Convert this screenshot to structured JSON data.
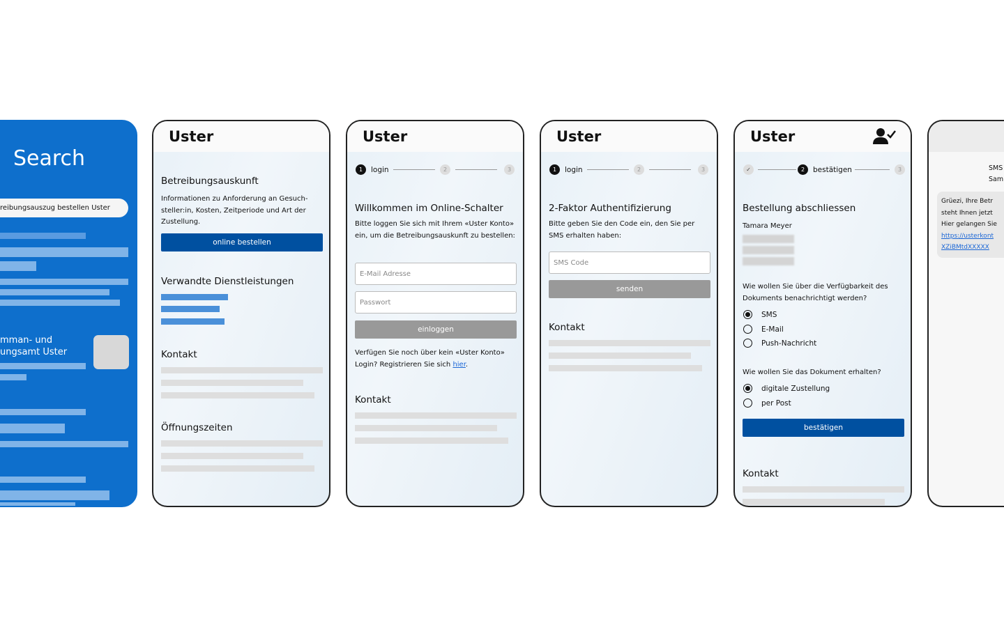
{
  "search_screen": {
    "title": "Search",
    "query": "reibungsauszug bestellen Uster",
    "result_title_line1": "mman- und",
    "result_title_line2": "ungsamt Uster"
  },
  "brand": "Uster",
  "screen1": {
    "heading": "Betreibungsauskunft",
    "text": "Informationen zu Anforderung an Gesuch-steller:in, Kosten, Zeitperiode und Art der Zustellung.",
    "button": "online bestellen",
    "related": "Verwandte Dienstleistungen",
    "contact": "Kontakt",
    "hours": "Öffnungszeiten"
  },
  "screen2": {
    "steps": [
      {
        "label": "login",
        "num": "1"
      },
      {
        "num": "2"
      },
      {
        "num": "3"
      }
    ],
    "heading": "Willkommen im Online-Schalter",
    "text": "Bitte loggen Sie sich mit Ihrem «Uster Konto» ein, um die Betreibungsauskunft zu bestellen:",
    "email_placeholder": "E-Mail Adresse",
    "password_placeholder": "Passwort",
    "button": "einloggen",
    "register_text": "Verfügen Sie noch über kein «Uster Konto» Login? Registrieren Sie sich ",
    "register_link": "hier",
    "register_end": ".",
    "contact": "Kontakt"
  },
  "screen3": {
    "steps": [
      {
        "label": "login",
        "num": "1"
      },
      {
        "num": "2"
      },
      {
        "num": "3"
      }
    ],
    "heading": "2-Faktor Authentifizierung",
    "text": "Bitte geben Sie den Code ein, den Sie per SMS erhalten haben:",
    "code_placeholder": "SMS Code",
    "button": "senden",
    "contact": "Kontakt"
  },
  "screen4": {
    "steps": [
      {
        "label": "",
        "num": "✓"
      },
      {
        "label": "bestätigen",
        "num": "2"
      },
      {
        "num": "3"
      }
    ],
    "heading": "Bestellung abschliessen",
    "name": "Tamara Meyer",
    "q1": "Wie wollen Sie über die Verfügbarkeit des Dokuments benachrichtigt werden?",
    "q1_options": [
      {
        "label": "SMS",
        "selected": true
      },
      {
        "label": "E-Mail",
        "selected": false
      },
      {
        "label": "Push-Nachricht",
        "selected": false
      }
    ],
    "q2": "Wie wollen Sie das Dokument erhalten?",
    "q2_options": [
      {
        "label": "digitale Zustellung",
        "selected": true
      },
      {
        "label": "per Post",
        "selected": false
      }
    ],
    "button": "bestätigen",
    "contact": "Kontakt",
    "user_icon": "user-check-icon"
  },
  "screen5": {
    "sender_line1": "SMS",
    "sender_line2": "Sam",
    "message_lines": [
      "Grüezi, Ihre Betr",
      "steht Ihnen jetzt",
      "Hier gelangen Sie"
    ],
    "link_line1": "https://usterkont",
    "link_line2": "XZiBMtdXXXXX"
  },
  "colors": {
    "primary": "#0050a0",
    "search_bg": "#0e6fcc",
    "disabled": "#999999",
    "link": "#1a66d6"
  }
}
